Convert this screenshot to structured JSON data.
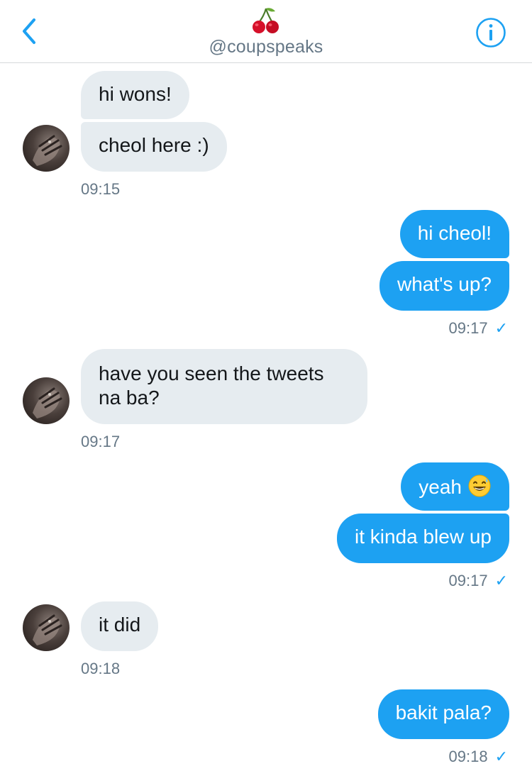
{
  "header": {
    "handle": "@coupspeaks",
    "back_icon": "chevron-left-icon",
    "info_icon": "info-circle-icon",
    "emoji_icon": "cherries-emoji",
    "accent_color": "#1da1f2"
  },
  "messages": [
    {
      "dir": "in",
      "text": "hi wons!"
    },
    {
      "dir": "in",
      "text": "cheol here :)",
      "time": "09:15"
    },
    {
      "dir": "out",
      "text": "hi cheol!"
    },
    {
      "dir": "out",
      "text": "what's up?",
      "time": "09:17",
      "read": true
    },
    {
      "dir": "in",
      "text": "have you seen the tweets na ba?",
      "time": "09:17"
    },
    {
      "dir": "out",
      "text": "yeah",
      "emoji": "grinning-sweat-emoji"
    },
    {
      "dir": "out",
      "text": "it kinda blew up",
      "time": "09:17",
      "read": true
    },
    {
      "dir": "in",
      "text": "it did",
      "time": "09:18"
    },
    {
      "dir": "out",
      "text": "bakit pala?",
      "time": "09:18",
      "read": true
    }
  ],
  "read_check_glyph": "✓",
  "colors": {
    "incoming_bubble": "#e6ecf0",
    "outgoing_bubble": "#1da1f2",
    "timestamp": "#657786"
  }
}
